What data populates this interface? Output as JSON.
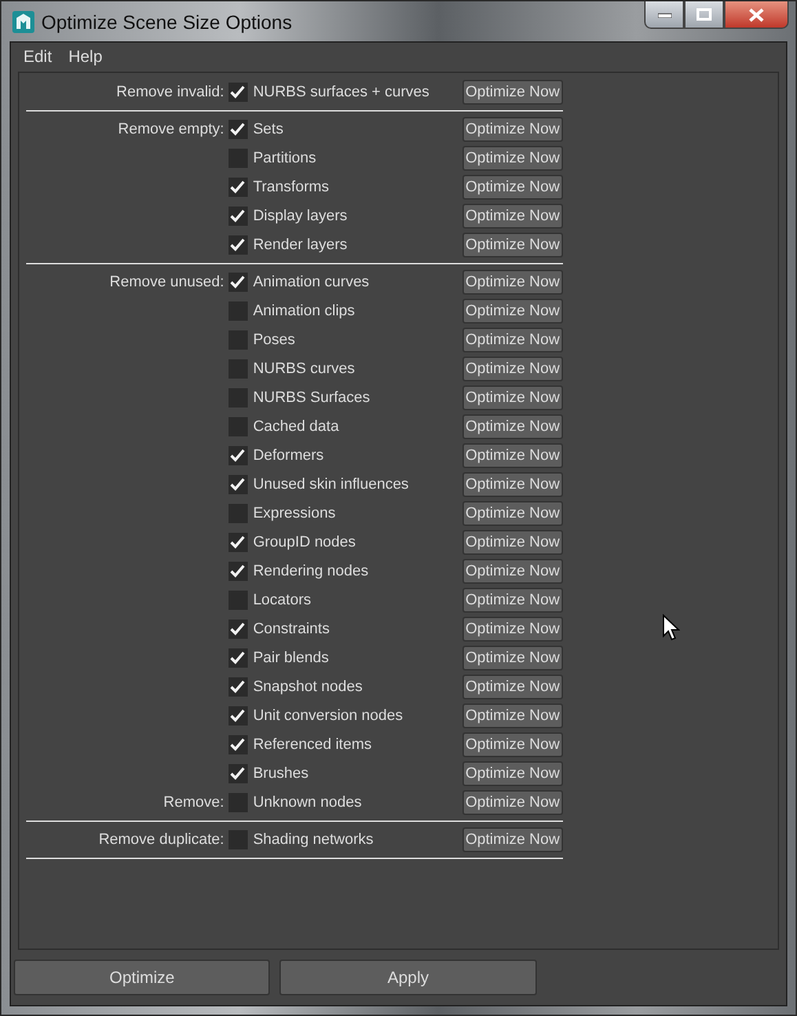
{
  "window": {
    "title": "Optimize Scene Size Options"
  },
  "menu": [
    "Edit",
    "Help"
  ],
  "groups": [
    {
      "rows": [
        {
          "label": "Remove invalid:",
          "name": "NURBS surfaces + curves",
          "checked": true,
          "button": "Optimize Now"
        }
      ]
    },
    {
      "rows": [
        {
          "label": "Remove empty:",
          "name": "Sets",
          "checked": true,
          "button": "Optimize Now"
        },
        {
          "name": "Partitions",
          "checked": false,
          "button": "Optimize Now"
        },
        {
          "name": "Transforms",
          "checked": true,
          "button": "Optimize Now"
        },
        {
          "name": "Display layers",
          "checked": true,
          "button": "Optimize Now"
        },
        {
          "name": "Render layers",
          "checked": true,
          "button": "Optimize Now"
        }
      ]
    },
    {
      "rows": [
        {
          "label": "Remove unused:",
          "name": "Animation curves",
          "checked": true,
          "button": "Optimize Now"
        },
        {
          "name": "Animation clips",
          "checked": false,
          "button": "Optimize Now"
        },
        {
          "name": "Poses",
          "checked": false,
          "button": "Optimize Now"
        },
        {
          "name": "NURBS curves",
          "checked": false,
          "button": "Optimize Now"
        },
        {
          "name": "NURBS Surfaces",
          "checked": false,
          "button": "Optimize Now"
        },
        {
          "name": "Cached data",
          "checked": false,
          "button": "Optimize Now"
        },
        {
          "name": "Deformers",
          "checked": true,
          "button": "Optimize Now"
        },
        {
          "name": "Unused skin influences",
          "checked": true,
          "button": "Optimize Now"
        },
        {
          "name": "Expressions",
          "checked": false,
          "button": "Optimize Now"
        },
        {
          "name": "GroupID nodes",
          "checked": true,
          "button": "Optimize Now"
        },
        {
          "name": "Rendering nodes",
          "checked": true,
          "button": "Optimize Now"
        },
        {
          "name": "Locators",
          "checked": false,
          "button": "Optimize Now"
        },
        {
          "name": "Constraints",
          "checked": true,
          "button": "Optimize Now"
        },
        {
          "name": "Pair blends",
          "checked": true,
          "button": "Optimize Now"
        },
        {
          "name": "Snapshot nodes",
          "checked": true,
          "button": "Optimize Now"
        },
        {
          "name": "Unit conversion nodes",
          "checked": true,
          "button": "Optimize Now"
        },
        {
          "name": "Referenced items",
          "checked": true,
          "button": "Optimize Now"
        },
        {
          "name": "Brushes",
          "checked": true,
          "button": "Optimize Now"
        },
        {
          "label": "Remove:",
          "name": "Unknown nodes",
          "checked": false,
          "button": "Optimize Now"
        }
      ]
    },
    {
      "rows": [
        {
          "label": "Remove duplicate:",
          "name": "Shading networks",
          "checked": false,
          "button": "Optimize Now"
        }
      ]
    }
  ],
  "buttons": [
    "Optimize",
    "Apply"
  ]
}
